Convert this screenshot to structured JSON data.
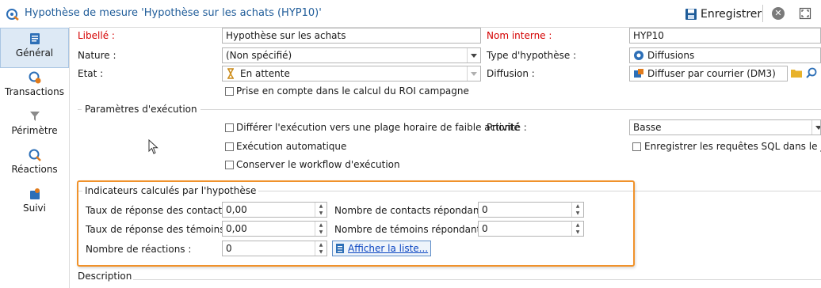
{
  "window": {
    "title": "Hypothèse de mesure 'Hypothèse sur les achats (HYP10)'",
    "save_label": "Enregistrer"
  },
  "sidebar": {
    "items": [
      {
        "label": "Général",
        "icon": "general-icon"
      },
      {
        "label": "Transactions",
        "icon": "transactions-icon"
      },
      {
        "label": "Périmètre",
        "icon": "filter-icon"
      },
      {
        "label": "Réactions",
        "icon": "reactions-icon"
      },
      {
        "label": "Suivi",
        "icon": "tracking-icon"
      }
    ]
  },
  "form": {
    "libelle_label": "Libellé :",
    "libelle_value": "Hypothèse sur les achats",
    "nom_interne_label": "Nom interne :",
    "nom_interne_value": "HYP10",
    "nature_label": "Nature :",
    "nature_value": "(Non spécifié)",
    "type_label": "Type d'hypothèse :",
    "type_value": "Diffusions",
    "etat_label": "Etat :",
    "etat_value": "En attente",
    "diffusion_label": "Diffusion :",
    "diffusion_value": "Diffuser par courrier (DM3)",
    "roi_label": "Prise en compte dans le calcul du ROI campagne"
  },
  "execution": {
    "section_title": "Paramètres d'exécution",
    "differer_label": "Différer l'exécution vers une plage horaire de faible activité",
    "priorite_label": "Priorité :",
    "priorite_value": "Basse",
    "auto_label": "Exécution automatique",
    "sql_label": "Enregistrer les requêtes SQL dans le journa",
    "workflow_label": "Conserver le workflow d'exécution"
  },
  "indicators": {
    "section_title": "Indicateurs calculés par l'hypothèse",
    "taux_contacts_label": "Taux de réponse des contacts :",
    "taux_contacts_value": "0,00",
    "nb_contacts_label": "Nombre de contacts répondants :",
    "nb_contacts_value": "0",
    "taux_temoins_label": "Taux de réponse des témoins :",
    "taux_temoins_value": "0,00",
    "nb_temoins_label": "Nombre de témoins répondants :",
    "nb_temoins_value": "0",
    "nb_reactions_label": "Nombre de réactions :",
    "nb_reactions_value": "0",
    "afficher_label": "Afficher la liste..."
  },
  "description": {
    "section_title": "Description"
  },
  "colors": {
    "accent": "#1f5c99",
    "highlight": "#f0922b",
    "required": "#d40000",
    "link": "#0b46c2"
  }
}
